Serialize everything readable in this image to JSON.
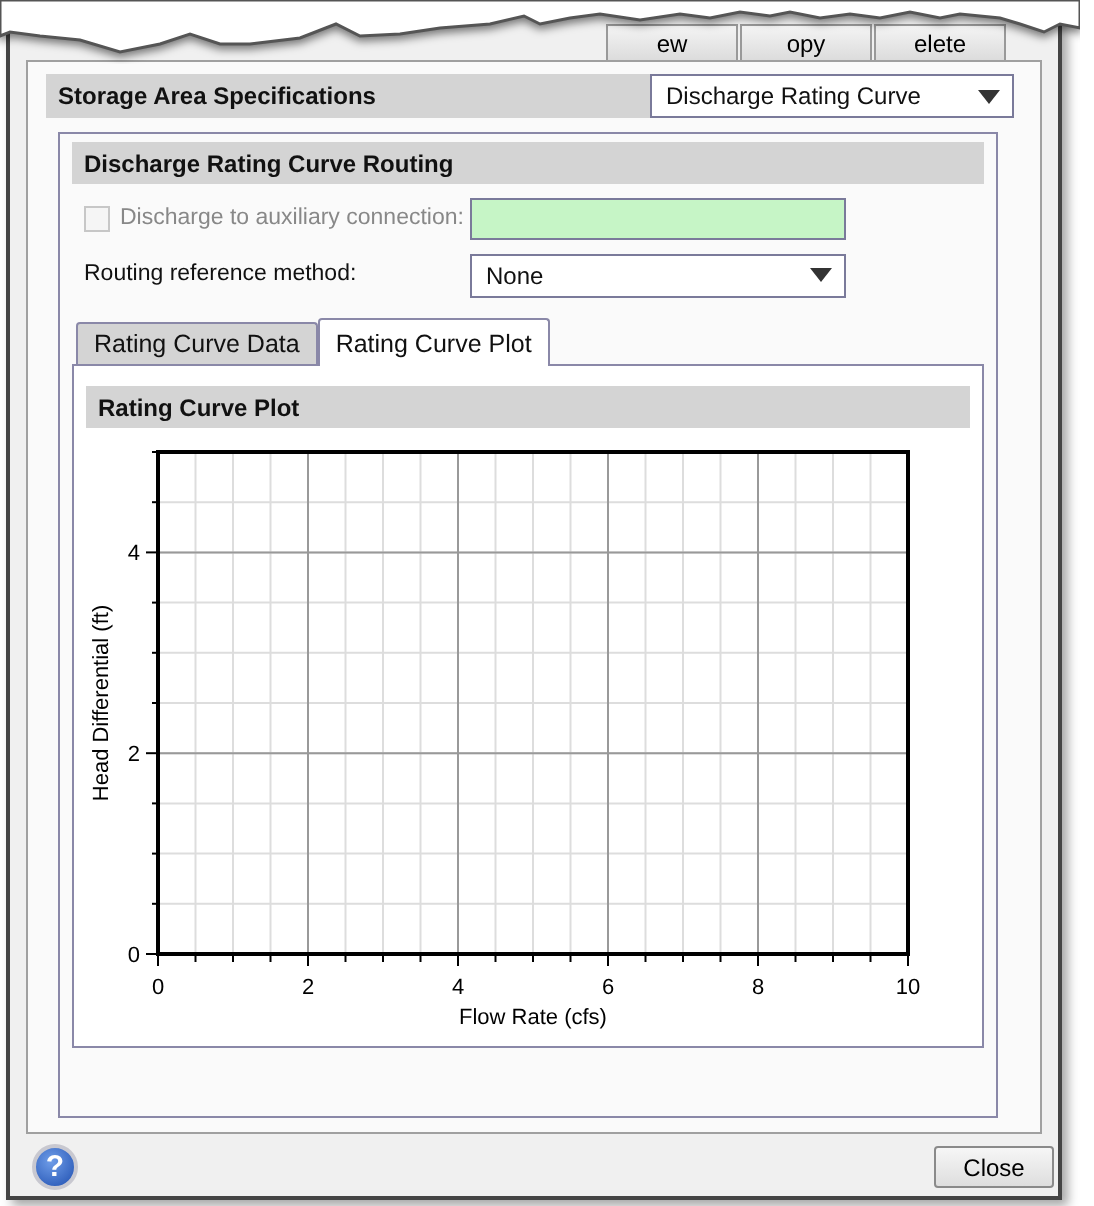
{
  "toolbar": {
    "buttons": [
      "ew",
      "opy",
      "elete"
    ]
  },
  "specifications": {
    "title": "Storage Area Specifications",
    "dropdown": {
      "value": "Discharge Rating Curve"
    }
  },
  "routing": {
    "title": "Discharge Rating Curve Routing",
    "auxiliary": {
      "label": "Discharge to auxiliary connection:",
      "checked": false,
      "disabled": true
    },
    "reference": {
      "label": "Routing reference method:",
      "value": "None"
    },
    "tabs": [
      {
        "label": "Rating Curve Data",
        "selected": false
      },
      {
        "label": "Rating Curve Plot",
        "selected": true
      }
    ],
    "plot": {
      "title": "Rating Curve Plot",
      "chart_data": {
        "type": "line",
        "xlabel": "Flow Rate (cfs)",
        "ylabel": "Head Differential (ft)",
        "xlim": [
          0,
          10
        ],
        "ylim": [
          0,
          5
        ],
        "xticks": [
          0,
          2,
          4,
          6,
          8,
          10
        ],
        "yticks": [
          0,
          2,
          4
        ],
        "grid": true
      }
    }
  },
  "footer": {
    "help_button": "?",
    "close_button": "Close"
  }
}
